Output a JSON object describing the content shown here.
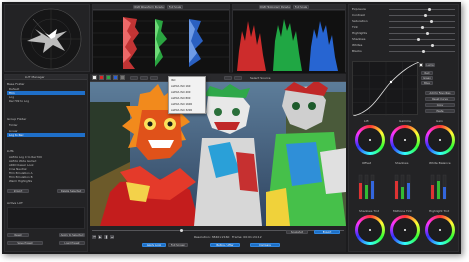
{
  "colors": {
    "accent": "#1f6fc9",
    "panel": "#232325",
    "background": "#1c1c1e"
  },
  "top_scopes": {
    "waveform_header": {
      "btn1": "RGB Waveform Parade",
      "btn2": "Full Scale"
    },
    "histogram_header": {
      "btn1": "RGB Histogram Parade",
      "btn2": "Full Scale"
    }
  },
  "left_panel": {
    "header": "LUT Manager",
    "section1_title": "Base Folder",
    "section1_rows": [
      "Default",
      "Film",
      "Log",
      "Rec709 to Log"
    ],
    "section2_title": "Group Folder",
    "section2_rows": [
      "Folder",
      "Linear",
      "Log to Rec"
    ],
    "section3_title": "LUTs",
    "section3_rows": [
      "ALEXA Log C to Rec709",
      "ALEXA Wide Gamut",
      "ARRI Classic Look",
      "Cine Neutral",
      "Film Emulation A",
      "Film Emulation B",
      "Warm Highlights"
    ],
    "import_btn": "Import",
    "delete_btn": "Delete Selected",
    "bottom_title": "Active LUT",
    "bottom_btns": [
      "Reset",
      "Apply to Selected",
      "Save Preset",
      "Load Preset"
    ]
  },
  "viewer": {
    "dropdown_items": [
      "ISO",
      "ALEXA ISO 160",
      "ALEXA ISO 400",
      "ALEXA ISO 800",
      "ALEXA ISO 1600",
      "ALEXA ISO 3200"
    ],
    "toolbar_label": "Select Source",
    "bottom_bar": {
      "btn_a": "Apply Look",
      "btn_b": "Full Screen",
      "readout_a": "Resolution: 3840×2160",
      "readout_b": "Frame: 00:01:24:12",
      "btn_c": "Before / After",
      "btn_d": "Compare"
    },
    "right_btns": [
      "Snapshot",
      "Export"
    ]
  },
  "right_panel": {
    "sliders": [
      "Exposure",
      "Contrast",
      "Saturation",
      "Tint",
      "Highlights",
      "Shadows",
      "Whites",
      "Blacks"
    ],
    "slider_values": [
      0.62,
      0.55,
      0.65,
      0.5,
      0.58,
      0.45,
      0.66,
      0.52
    ],
    "curve_buttons": [
      "Luma",
      "Red",
      "Green",
      "Blue"
    ],
    "curve_side_btns": [
      "Add to Favorites",
      "Reset Curve",
      "Copy",
      "Paste"
    ],
    "wheel_titles_top": [
      "Lift",
      "Gamma",
      "Gain"
    ],
    "wheel_titles_mid": [
      "Offset",
      "Shadows",
      "White Balance"
    ],
    "wheel_titles_bottom": [
      "Shadows Tint",
      "Midtone Tint",
      "Highlight Tint"
    ]
  }
}
